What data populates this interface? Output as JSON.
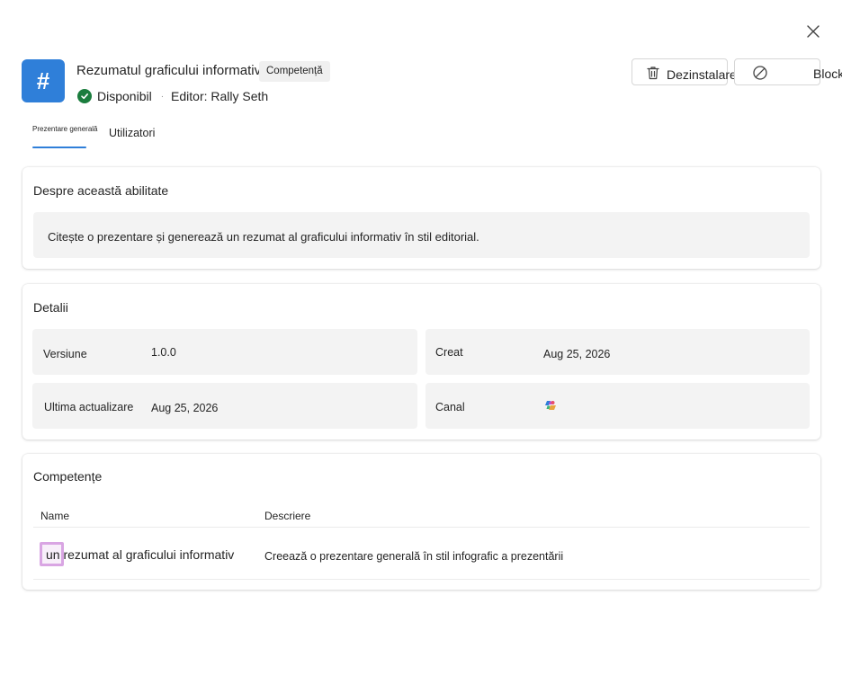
{
  "dialog": {
    "close_icon": "close-icon"
  },
  "header": {
    "app_icon_glyph": "#",
    "app_icon_color": "#2f7fd9",
    "title": "Rezumatul graficului informativ",
    "type_badge": "Competență",
    "status": "Disponibil",
    "status_color": "#1b7d3e",
    "separator": "·",
    "publisher": "Editor: Rally Seth"
  },
  "actions": {
    "uninstall_label": "Dezinstalarea",
    "uninstall_icon": "trash-icon",
    "block_label": "Block",
    "block_icon": "block-icon"
  },
  "tabs": [
    {
      "label": "Prezentare generală",
      "active": true
    },
    {
      "label": "Utilizatori",
      "active": false
    }
  ],
  "about": {
    "title": "Despre această abilitate",
    "text": "Citește o prezentare și generează un rezumat al graficului informativ în stil editorial."
  },
  "details": {
    "title": "Detalii",
    "version_label": "Versiune",
    "version_value": "1.0.0",
    "created_label": "Creat",
    "created_value": "Aug 25, 2026",
    "updated_label": "Ultima actualizare",
    "updated_value": "Aug 25, 2026",
    "channel_label": "Canal",
    "channel_icon": "copilot-icon"
  },
  "skills": {
    "title": "Competențe",
    "columns": {
      "name": "Name",
      "description": "Descriere"
    },
    "rows": [
      {
        "name": "un rezumat al graficului informativ",
        "description": "Creează o prezentare generală în stil infografic a prezentării"
      }
    ]
  },
  "colors": {
    "accent": "#2f7fd9",
    "highlight": "#d9a5e3"
  }
}
